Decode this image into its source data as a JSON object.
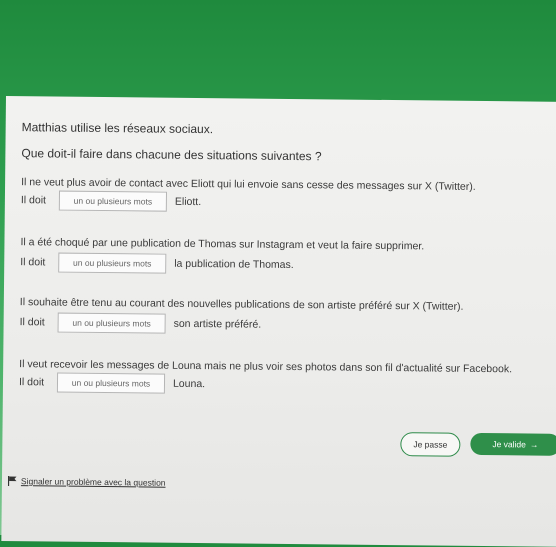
{
  "intro": "Matthias utilise les réseaux sociaux.",
  "question": "Que doit-il faire dans chacune des situations suivantes ?",
  "situations": [
    {
      "text": "Il ne veut plus avoir de contact avec Eliott qui lui envoie sans cesse des messages sur X (Twitter).",
      "prefix": "Il doit",
      "blank": "un ou plusieurs mots",
      "suffix": "Eliott."
    },
    {
      "text": "Il a été choqué par une publication de Thomas sur Instagram et veut la faire supprimer.",
      "prefix": "Il doit",
      "blank": "un ou plusieurs mots",
      "suffix": "la publication de Thomas."
    },
    {
      "text": "Il souhaite être tenu au courant des nouvelles publications de son artiste préféré sur X (Twitter).",
      "prefix": "Il doit",
      "blank": "un ou plusieurs mots",
      "suffix": "son artiste préféré."
    },
    {
      "text": "Il veut recevoir les messages de Louna mais ne plus voir ses photos dans son fil d'actualité sur Facebook.",
      "prefix": "Il doit",
      "blank": "un ou plusieurs mots",
      "suffix": "Louna."
    }
  ],
  "buttons": {
    "skip": "Je passe",
    "validate": "Je valide",
    "validate_arrow": "→"
  },
  "report": "Signaler un problème avec la question",
  "colors": {
    "accent": "#2f8f4a",
    "background": "#2e9f4f"
  }
}
